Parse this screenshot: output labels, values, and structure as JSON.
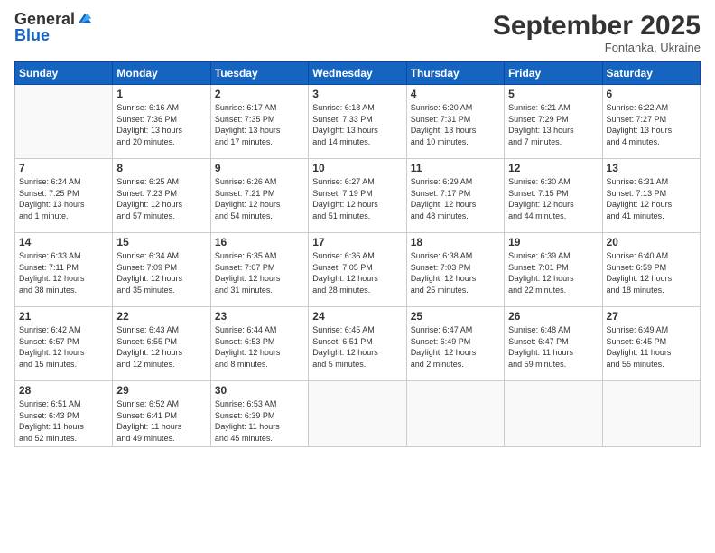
{
  "header": {
    "logo_general": "General",
    "logo_blue": "Blue",
    "month_title": "September 2025",
    "subtitle": "Fontanka, Ukraine"
  },
  "days_of_week": [
    "Sunday",
    "Monday",
    "Tuesday",
    "Wednesday",
    "Thursday",
    "Friday",
    "Saturday"
  ],
  "weeks": [
    [
      {
        "day": "",
        "info": ""
      },
      {
        "day": "1",
        "info": "Sunrise: 6:16 AM\nSunset: 7:36 PM\nDaylight: 13 hours\nand 20 minutes."
      },
      {
        "day": "2",
        "info": "Sunrise: 6:17 AM\nSunset: 7:35 PM\nDaylight: 13 hours\nand 17 minutes."
      },
      {
        "day": "3",
        "info": "Sunrise: 6:18 AM\nSunset: 7:33 PM\nDaylight: 13 hours\nand 14 minutes."
      },
      {
        "day": "4",
        "info": "Sunrise: 6:20 AM\nSunset: 7:31 PM\nDaylight: 13 hours\nand 10 minutes."
      },
      {
        "day": "5",
        "info": "Sunrise: 6:21 AM\nSunset: 7:29 PM\nDaylight: 13 hours\nand 7 minutes."
      },
      {
        "day": "6",
        "info": "Sunrise: 6:22 AM\nSunset: 7:27 PM\nDaylight: 13 hours\nand 4 minutes."
      }
    ],
    [
      {
        "day": "7",
        "info": "Sunrise: 6:24 AM\nSunset: 7:25 PM\nDaylight: 13 hours\nand 1 minute."
      },
      {
        "day": "8",
        "info": "Sunrise: 6:25 AM\nSunset: 7:23 PM\nDaylight: 12 hours\nand 57 minutes."
      },
      {
        "day": "9",
        "info": "Sunrise: 6:26 AM\nSunset: 7:21 PM\nDaylight: 12 hours\nand 54 minutes."
      },
      {
        "day": "10",
        "info": "Sunrise: 6:27 AM\nSunset: 7:19 PM\nDaylight: 12 hours\nand 51 minutes."
      },
      {
        "day": "11",
        "info": "Sunrise: 6:29 AM\nSunset: 7:17 PM\nDaylight: 12 hours\nand 48 minutes."
      },
      {
        "day": "12",
        "info": "Sunrise: 6:30 AM\nSunset: 7:15 PM\nDaylight: 12 hours\nand 44 minutes."
      },
      {
        "day": "13",
        "info": "Sunrise: 6:31 AM\nSunset: 7:13 PM\nDaylight: 12 hours\nand 41 minutes."
      }
    ],
    [
      {
        "day": "14",
        "info": "Sunrise: 6:33 AM\nSunset: 7:11 PM\nDaylight: 12 hours\nand 38 minutes."
      },
      {
        "day": "15",
        "info": "Sunrise: 6:34 AM\nSunset: 7:09 PM\nDaylight: 12 hours\nand 35 minutes."
      },
      {
        "day": "16",
        "info": "Sunrise: 6:35 AM\nSunset: 7:07 PM\nDaylight: 12 hours\nand 31 minutes."
      },
      {
        "day": "17",
        "info": "Sunrise: 6:36 AM\nSunset: 7:05 PM\nDaylight: 12 hours\nand 28 minutes."
      },
      {
        "day": "18",
        "info": "Sunrise: 6:38 AM\nSunset: 7:03 PM\nDaylight: 12 hours\nand 25 minutes."
      },
      {
        "day": "19",
        "info": "Sunrise: 6:39 AM\nSunset: 7:01 PM\nDaylight: 12 hours\nand 22 minutes."
      },
      {
        "day": "20",
        "info": "Sunrise: 6:40 AM\nSunset: 6:59 PM\nDaylight: 12 hours\nand 18 minutes."
      }
    ],
    [
      {
        "day": "21",
        "info": "Sunrise: 6:42 AM\nSunset: 6:57 PM\nDaylight: 12 hours\nand 15 minutes."
      },
      {
        "day": "22",
        "info": "Sunrise: 6:43 AM\nSunset: 6:55 PM\nDaylight: 12 hours\nand 12 minutes."
      },
      {
        "day": "23",
        "info": "Sunrise: 6:44 AM\nSunset: 6:53 PM\nDaylight: 12 hours\nand 8 minutes."
      },
      {
        "day": "24",
        "info": "Sunrise: 6:45 AM\nSunset: 6:51 PM\nDaylight: 12 hours\nand 5 minutes."
      },
      {
        "day": "25",
        "info": "Sunrise: 6:47 AM\nSunset: 6:49 PM\nDaylight: 12 hours\nand 2 minutes."
      },
      {
        "day": "26",
        "info": "Sunrise: 6:48 AM\nSunset: 6:47 PM\nDaylight: 11 hours\nand 59 minutes."
      },
      {
        "day": "27",
        "info": "Sunrise: 6:49 AM\nSunset: 6:45 PM\nDaylight: 11 hours\nand 55 minutes."
      }
    ],
    [
      {
        "day": "28",
        "info": "Sunrise: 6:51 AM\nSunset: 6:43 PM\nDaylight: 11 hours\nand 52 minutes."
      },
      {
        "day": "29",
        "info": "Sunrise: 6:52 AM\nSunset: 6:41 PM\nDaylight: 11 hours\nand 49 minutes."
      },
      {
        "day": "30",
        "info": "Sunrise: 6:53 AM\nSunset: 6:39 PM\nDaylight: 11 hours\nand 45 minutes."
      },
      {
        "day": "",
        "info": ""
      },
      {
        "day": "",
        "info": ""
      },
      {
        "day": "",
        "info": ""
      },
      {
        "day": "",
        "info": ""
      }
    ]
  ]
}
